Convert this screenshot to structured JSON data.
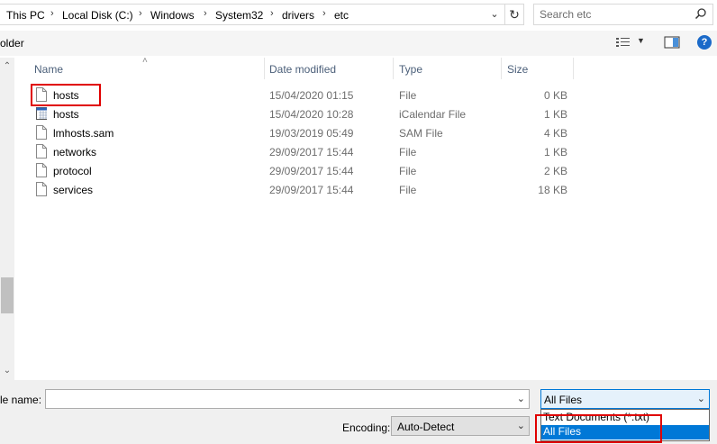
{
  "address": {
    "crumbs": [
      "This PC",
      "Local Disk (C:)",
      "Windows",
      "System32",
      "drivers",
      "etc"
    ],
    "separator": "›"
  },
  "search": {
    "placeholder": "Search etc"
  },
  "toolbar": {
    "new_folder_label": "older",
    "help_label": "?"
  },
  "columns": {
    "name": "Name",
    "date": "Date modified",
    "type": "Type",
    "size": "Size"
  },
  "files": [
    {
      "name": "hosts",
      "date": "15/04/2020 01:15",
      "type": "File",
      "size": "0 KB",
      "icon": "file-icon"
    },
    {
      "name": "hosts",
      "date": "15/04/2020 10:28",
      "type": "iCalendar File",
      "size": "1 KB",
      "icon": "calendar-file-icon"
    },
    {
      "name": "lmhosts.sam",
      "date": "19/03/2019 05:49",
      "type": "SAM File",
      "size": "4 KB",
      "icon": "file-icon"
    },
    {
      "name": "networks",
      "date": "29/09/2017 15:44",
      "type": "File",
      "size": "1 KB",
      "icon": "file-icon"
    },
    {
      "name": "protocol",
      "date": "29/09/2017 15:44",
      "type": "File",
      "size": "2 KB",
      "icon": "file-icon"
    },
    {
      "name": "services",
      "date": "29/09/2017 15:44",
      "type": "File",
      "size": "18 KB",
      "icon": "file-icon"
    }
  ],
  "bottom": {
    "file_name_label": "le name:",
    "file_name_value": "",
    "file_type_selected": "All Files",
    "encoding_label": "Encoding:",
    "encoding_value": "Auto-Detect"
  },
  "file_type_options": [
    "Text Documents (*.txt)",
    "All Files"
  ],
  "colors": {
    "accent": "#0078d7",
    "highlight_box": "#e00000",
    "help": "#1b6ac9"
  }
}
